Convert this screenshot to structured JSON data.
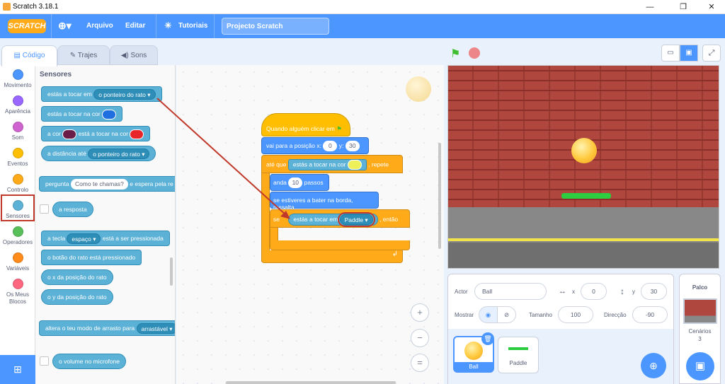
{
  "window": {
    "title": "Scratch 3.18.1",
    "min": "—",
    "max": "❐",
    "close": "✕"
  },
  "menu": {
    "logo": "SCRATCH",
    "file": "Arquivo",
    "edit": "Editar",
    "tutorials": "Tutoriais",
    "project_title": "Projecto Scratch"
  },
  "tabs": {
    "code": "Código",
    "costumes": "Trajes",
    "sounds": "Sons"
  },
  "categories": [
    {
      "label": "Movimento",
      "color": "#4c97ff"
    },
    {
      "label": "Aparência",
      "color": "#9966ff"
    },
    {
      "label": "Som",
      "color": "#cf63cf"
    },
    {
      "label": "Eventos",
      "color": "#ffbf00"
    },
    {
      "label": "Controlo",
      "color": "#ffab19"
    },
    {
      "label": "Sensores",
      "color": "#5cb1d6"
    },
    {
      "label": "Operadores",
      "color": "#59c059"
    },
    {
      "label": "Variáveis",
      "color": "#ff8c1a"
    },
    {
      "label": "Os Meus Blocos",
      "color": "#ff6680"
    }
  ],
  "palette": {
    "title": "Sensores",
    "b1": {
      "text": "estás a tocar em",
      "opt": "o ponteiro do rato"
    },
    "b2": {
      "text": "estás a tocar na cor"
    },
    "b3": {
      "a": "a cor",
      "b": "está a tocar na cor"
    },
    "b4": {
      "text": "a distância até",
      "opt": "o ponteiro do rato"
    },
    "b5": {
      "a": "pergunta",
      "val": "Como te chamas?",
      "b": "e espera pela re"
    },
    "b6": "a resposta",
    "b7": {
      "a": "a tecla",
      "opt": "espaço",
      "b": "está a ser pressionada"
    },
    "b8": "o botão do rato está pressionado",
    "b9": "o x da posição do rato",
    "b10": "o y da posição do rato",
    "b11": {
      "text": "altera o teu modo de arrasto para",
      "opt": "arrastável"
    },
    "b12": "o volume no microfone"
  },
  "script": {
    "hat": "Quando alguém clicar em",
    "goto": {
      "text": "vai para a posição x:",
      "x": "0",
      "ylabel": "y:",
      "y": "30"
    },
    "repeat": {
      "a": "até que",
      "b": "estás a tocar na cor",
      "c": ", repete"
    },
    "move": {
      "a": "anda",
      "n": "10",
      "b": "passos"
    },
    "bounce": "se estiveres a bater na borda, ressalta",
    "if": {
      "a": "se",
      "b": "estás a tocar em",
      "opt": "Paddle",
      "c": ", então"
    }
  },
  "zoom": {
    "in": "+",
    "out": "−",
    "reset": "="
  },
  "sprite_info": {
    "actor_label": "Actor",
    "actor": "Ball",
    "x_label": "x",
    "x": "0",
    "y_label": "y",
    "y": "30",
    "show_label": "Mostrar",
    "size_label": "Tamanho",
    "size": "100",
    "dir_label": "Direcção",
    "dir": "-90"
  },
  "sprites": [
    {
      "name": "Ball"
    },
    {
      "name": "Paddle"
    }
  ],
  "stage_pane": {
    "title": "Palco",
    "backdrops_label": "Cenários",
    "backdrops": "3"
  },
  "colors": {
    "accent": "#4c97ff",
    "red_box": "#c0392b",
    "ball": "#ffc93c",
    "paddle": "#2ecc40"
  }
}
